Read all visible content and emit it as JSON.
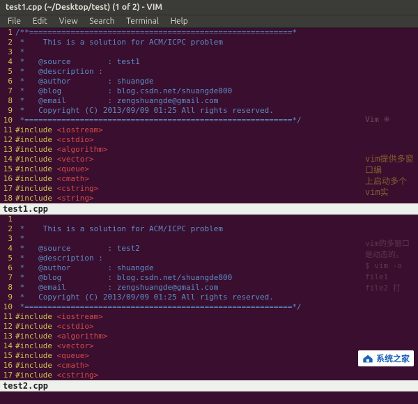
{
  "window": {
    "title": "test1.cpp (~/Desktop/test) (1 of 2) - VIM"
  },
  "menu": {
    "file": "File",
    "edit": "Edit",
    "view": "View",
    "search": "Search",
    "terminal": "Terminal",
    "help": "Help"
  },
  "pane1": {
    "status": "test1.cpp",
    "lines": [
      {
        "n": "1",
        "seg": [
          {
            "c": "c-comment",
            "t": "/**=========================================================*"
          }
        ]
      },
      {
        "n": "2",
        "seg": [
          {
            "c": "c-comment",
            "t": " *    This is a solution for ACM/ICPC problem"
          }
        ]
      },
      {
        "n": "3",
        "seg": [
          {
            "c": "c-comment",
            "t": " *"
          }
        ]
      },
      {
        "n": "4",
        "seg": [
          {
            "c": "c-comment",
            "t": " *   @source        : test1"
          }
        ]
      },
      {
        "n": "5",
        "seg": [
          {
            "c": "c-comment",
            "t": " *   @description : "
          }
        ]
      },
      {
        "n": "6",
        "seg": [
          {
            "c": "c-comment",
            "t": " *   @author        : shuangde"
          }
        ]
      },
      {
        "n": "7",
        "seg": [
          {
            "c": "c-comment",
            "t": " *   @blog          : blog.csdn.net/shuangde800"
          }
        ]
      },
      {
        "n": "8",
        "seg": [
          {
            "c": "c-comment",
            "t": " *   @email         : zengshuangde@gmail.com"
          }
        ]
      },
      {
        "n": "9",
        "seg": [
          {
            "c": "c-comment",
            "t": " *   Copyright (C) 2013/09/09 01:25 All rights reserved."
          }
        ]
      },
      {
        "n": "10",
        "seg": [
          {
            "c": "c-comment",
            "t": " *==========================================================*/"
          }
        ]
      },
      {
        "n": "11",
        "seg": [
          {
            "c": "c-keyword",
            "t": "#include "
          },
          {
            "c": "c-string",
            "t": "<iostream>"
          }
        ]
      },
      {
        "n": "12",
        "seg": [
          {
            "c": "c-keyword",
            "t": "#include "
          },
          {
            "c": "c-string",
            "t": "<cstdio>"
          }
        ]
      },
      {
        "n": "13",
        "seg": [
          {
            "c": "c-keyword",
            "t": "#include "
          },
          {
            "c": "c-string",
            "t": "<algorithm>"
          }
        ]
      },
      {
        "n": "14",
        "seg": [
          {
            "c": "c-keyword",
            "t": "#include "
          },
          {
            "c": "c-string",
            "t": "<vector>"
          }
        ]
      },
      {
        "n": "15",
        "seg": [
          {
            "c": "c-keyword",
            "t": "#include "
          },
          {
            "c": "c-string",
            "t": "<queue>"
          }
        ]
      },
      {
        "n": "16",
        "seg": [
          {
            "c": "c-keyword",
            "t": "#include "
          },
          {
            "c": "c-string",
            "t": "<cmath>"
          }
        ]
      },
      {
        "n": "17",
        "seg": [
          {
            "c": "c-keyword",
            "t": "#include "
          },
          {
            "c": "c-string",
            "t": "<cstring>"
          }
        ]
      },
      {
        "n": "18",
        "seg": [
          {
            "c": "c-keyword",
            "t": "#include "
          },
          {
            "c": "c-string",
            "t": "<string>"
          }
        ]
      }
    ],
    "side": {
      "l1": "Vim ※",
      "l2": "vim提供多窗口编",
      "l3": "上启动多个vim实"
    }
  },
  "pane2": {
    "status": "test2.cpp",
    "lines": [
      {
        "n": "1",
        "seg": [
          {
            "c": "c-comment",
            "t": ""
          }
        ]
      },
      {
        "n": "2",
        "seg": [
          {
            "c": "c-comment",
            "t": " *    This is a solution for ACM/ICPC problem"
          }
        ]
      },
      {
        "n": "3",
        "seg": [
          {
            "c": "c-comment",
            "t": " *"
          }
        ]
      },
      {
        "n": "4",
        "seg": [
          {
            "c": "c-comment",
            "t": " *   @source        : test2"
          }
        ]
      },
      {
        "n": "5",
        "seg": [
          {
            "c": "c-comment",
            "t": " *   @description : "
          }
        ]
      },
      {
        "n": "6",
        "seg": [
          {
            "c": "c-comment",
            "t": " *   @author        : shuangde"
          }
        ]
      },
      {
        "n": "7",
        "seg": [
          {
            "c": "c-comment",
            "t": " *   @blog          : blog.csdn.net/shuangde800"
          }
        ]
      },
      {
        "n": "8",
        "seg": [
          {
            "c": "c-comment",
            "t": " *   @email         : zengshuangde@gmail.com"
          }
        ]
      },
      {
        "n": "9",
        "seg": [
          {
            "c": "c-comment",
            "t": " *   Copyright (C) 2013/09/09 01:25 All rights reserved."
          }
        ]
      },
      {
        "n": "10",
        "seg": [
          {
            "c": "c-comment",
            "t": " *==========================================================*/"
          }
        ]
      },
      {
        "n": "11",
        "seg": [
          {
            "c": "c-keyword",
            "t": "#include "
          },
          {
            "c": "c-string",
            "t": "<iostream>"
          }
        ]
      },
      {
        "n": "12",
        "seg": [
          {
            "c": "c-keyword",
            "t": "#include "
          },
          {
            "c": "c-string",
            "t": "<cstdio>"
          }
        ]
      },
      {
        "n": "13",
        "seg": [
          {
            "c": "c-keyword",
            "t": "#include "
          },
          {
            "c": "c-string",
            "t": "<algorithm>"
          }
        ]
      },
      {
        "n": "14",
        "seg": [
          {
            "c": "c-keyword",
            "t": "#include "
          },
          {
            "c": "c-string",
            "t": "<vector>"
          }
        ]
      },
      {
        "n": "15",
        "seg": [
          {
            "c": "c-keyword",
            "t": "#include "
          },
          {
            "c": "c-string",
            "t": "<queue>"
          }
        ]
      },
      {
        "n": "16",
        "seg": [
          {
            "c": "c-keyword",
            "t": "#include "
          },
          {
            "c": "c-string",
            "t": "<cmath>"
          }
        ]
      },
      {
        "n": "17",
        "seg": [
          {
            "c": "c-keyword",
            "t": "#include "
          },
          {
            "c": "c-string",
            "t": "<cstring>"
          }
        ]
      }
    ],
    "side": {
      "l1": "vim的多窗口是动态的。",
      "l2": "$ vim -o file1 file2 打"
    }
  },
  "watermark": {
    "text": "系统之家"
  }
}
